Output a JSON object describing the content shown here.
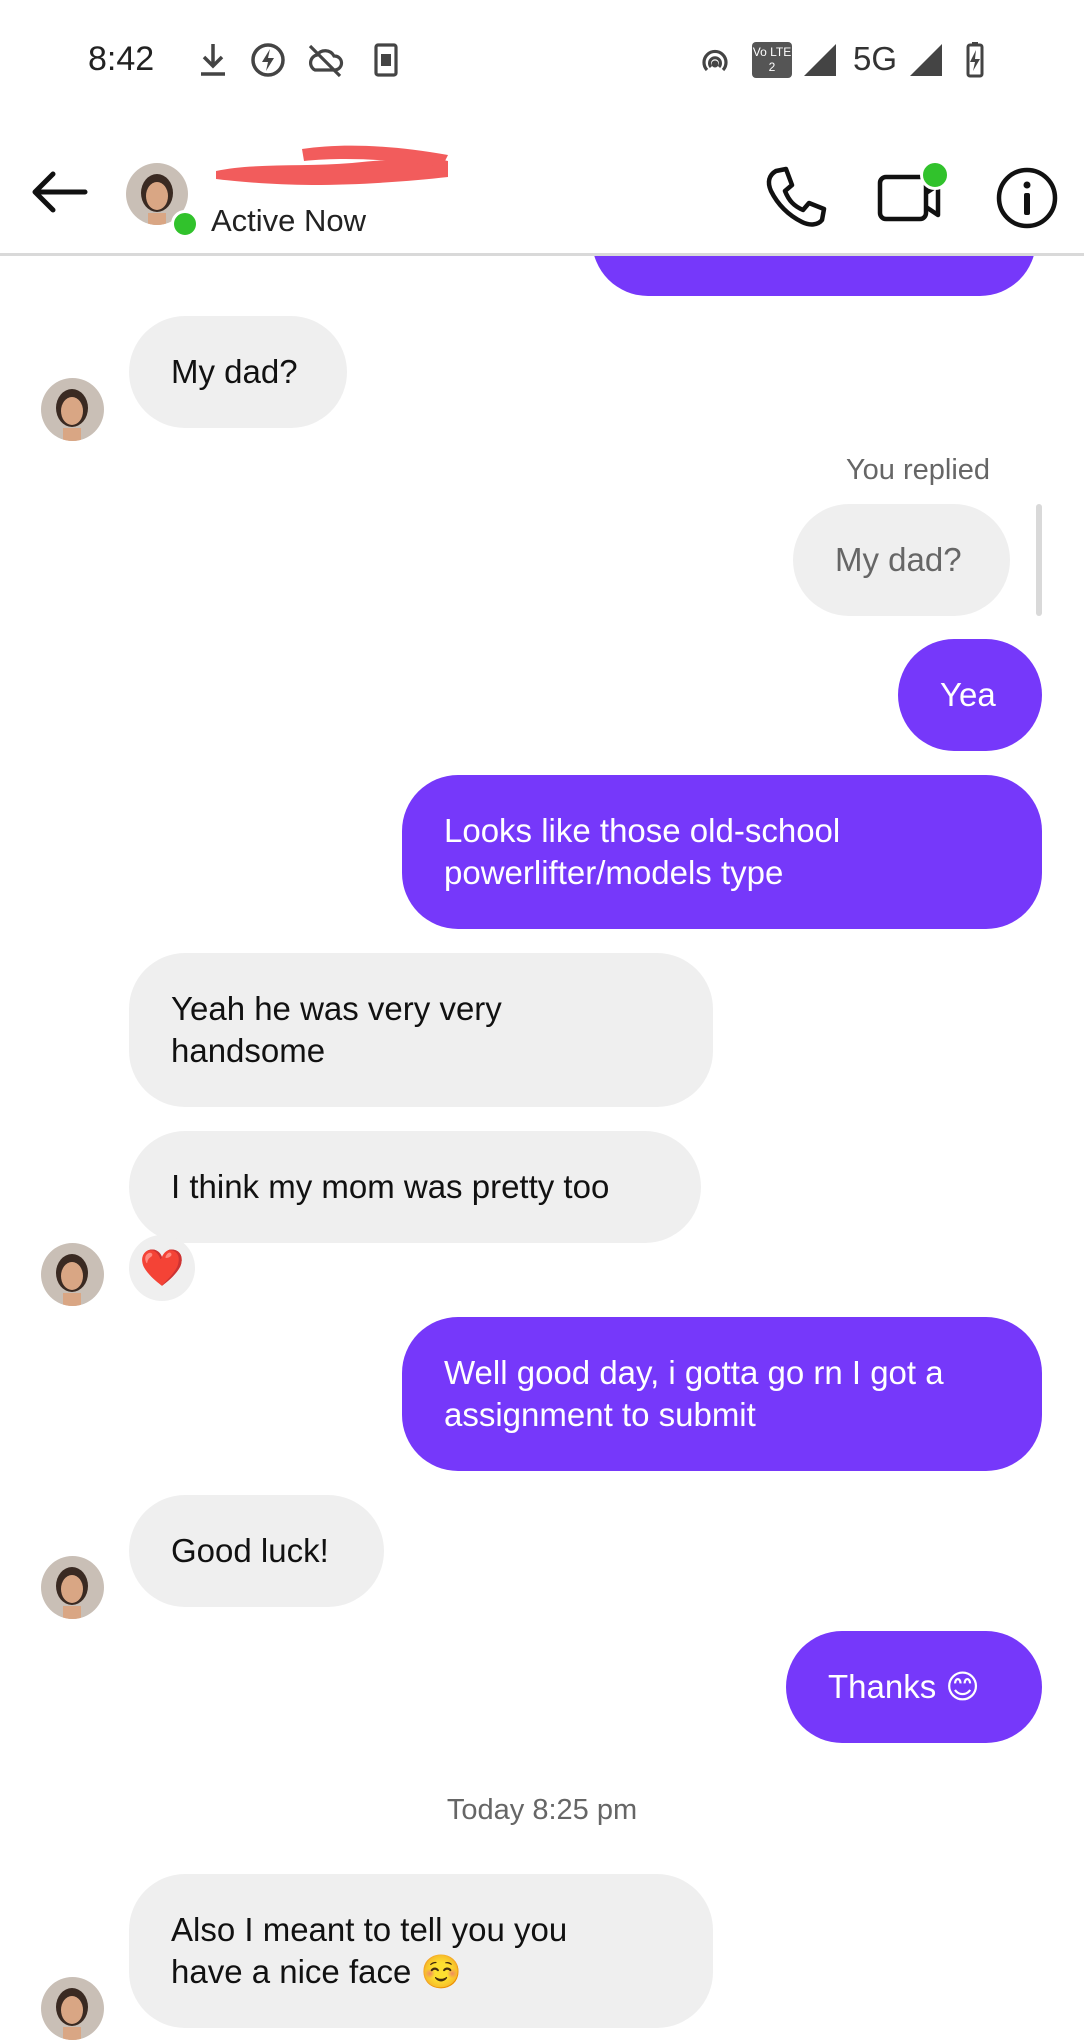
{
  "status_bar": {
    "time": "8:42",
    "network": "5G",
    "volte_label": "Vo LTE 2",
    "left_icons": [
      "download-icon",
      "battery-saver-icon",
      "no-cloud-icon",
      "screenshot-icon"
    ],
    "right_icons": [
      "hotspot-icon",
      "volte-icon",
      "signal-icon",
      "signal-icon",
      "battery-charging-icon"
    ]
  },
  "header": {
    "contact_name": "",
    "presence": "Active Now",
    "actions": [
      "phone-icon",
      "video-call-icon",
      "info-icon"
    ],
    "accent_online": "#31c22c"
  },
  "thread": {
    "messages": [
      {
        "from": "them",
        "text": "My dad?"
      },
      {
        "from": "me",
        "reply_label": "You replied",
        "quoted": "My dad?"
      },
      {
        "from": "me",
        "text": "Yea"
      },
      {
        "from": "me",
        "text": "Looks like those old-school powerlifter/models type"
      },
      {
        "from": "them",
        "text": "Yeah he was very very handsome"
      },
      {
        "from": "them",
        "text": "I think my mom was pretty too",
        "reaction": "❤️"
      },
      {
        "from": "me",
        "text": "Well good day, i gotta go rn I got a assignment to submit"
      },
      {
        "from": "them",
        "text": "Good luck!"
      },
      {
        "from": "me",
        "text": "Thanks 😊"
      },
      {
        "timestamp": "Today 8:25 pm"
      },
      {
        "from": "them",
        "text": "Also I meant to tell you you have a nice face ☺️"
      }
    ],
    "colors": {
      "outgoing": "#7638fa",
      "incoming": "#efefef"
    }
  }
}
